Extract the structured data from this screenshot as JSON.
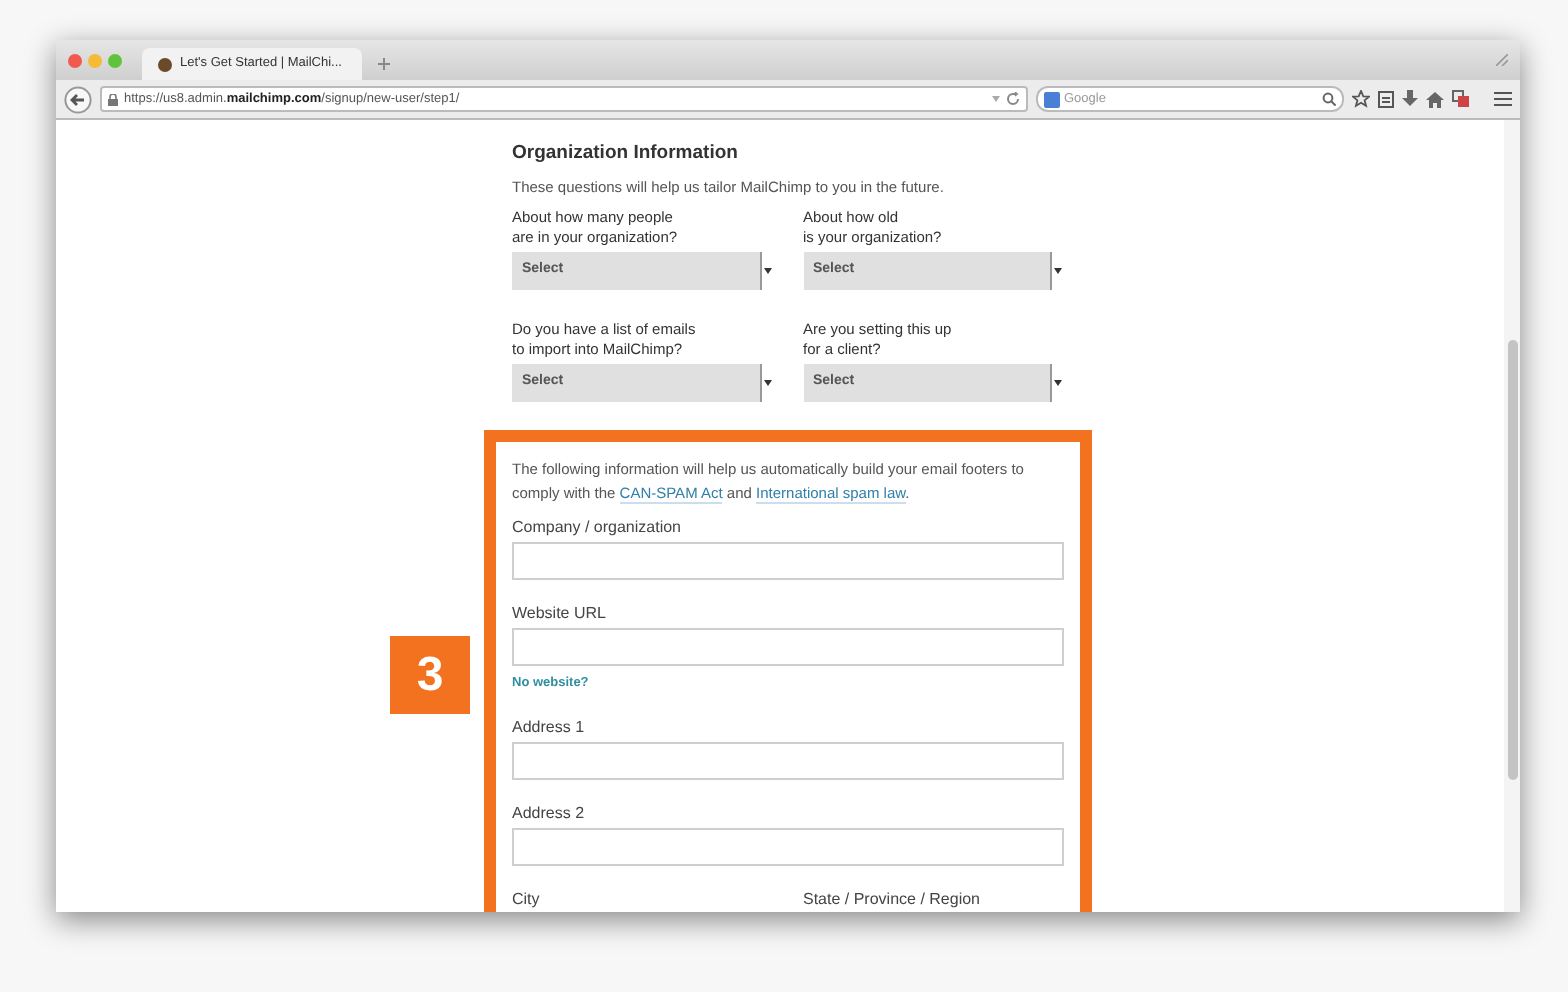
{
  "browser": {
    "tab_title": "Let's Get Started | MailChi...",
    "url": "https://us8.admin.**mailchimp.com**/signup/new-user/step1/",
    "search_placeholder": "Google"
  },
  "section": {
    "title": "Organization Information",
    "description": "These questions will help us tailor MailChimp to you in the future.",
    "questions": [
      {
        "label_lines": [
          "About how many people",
          "are in your organization?"
        ],
        "value": "Select"
      },
      {
        "label_lines": [
          "About how old",
          "is your organization?"
        ],
        "value": "Select"
      },
      {
        "label_lines": [
          "Do you have a list of emails",
          "to import into MailChimp?"
        ],
        "value": "Select"
      },
      {
        "label_lines": [
          "Are you setting this up",
          "for a client?"
        ],
        "value": "Select"
      }
    ]
  },
  "footer_info": {
    "parts": [
      {
        "kind": "text",
        "text": "The following information will help us automatically build your email footers to comply with the "
      },
      {
        "kind": "link",
        "text": "CAN-SPAM Act"
      },
      {
        "kind": "text",
        "text": " and "
      },
      {
        "kind": "link",
        "text": "International spam law"
      },
      {
        "kind": "text",
        "text": "."
      }
    ],
    "rows": [
      {
        "fields": [
          {
            "label": "Company / organization"
          }
        ]
      },
      {
        "fields": [
          {
            "label": "Website URL"
          }
        ],
        "link": "No website?"
      },
      {
        "fields": [
          {
            "label": "Address 1"
          }
        ]
      },
      {
        "fields": [
          {
            "label": "Address 2"
          }
        ]
      },
      {
        "fields": [
          {
            "label": "City"
          },
          {
            "label": "State / Province / Region"
          }
        ]
      }
    ]
  },
  "step_badge": "3"
}
